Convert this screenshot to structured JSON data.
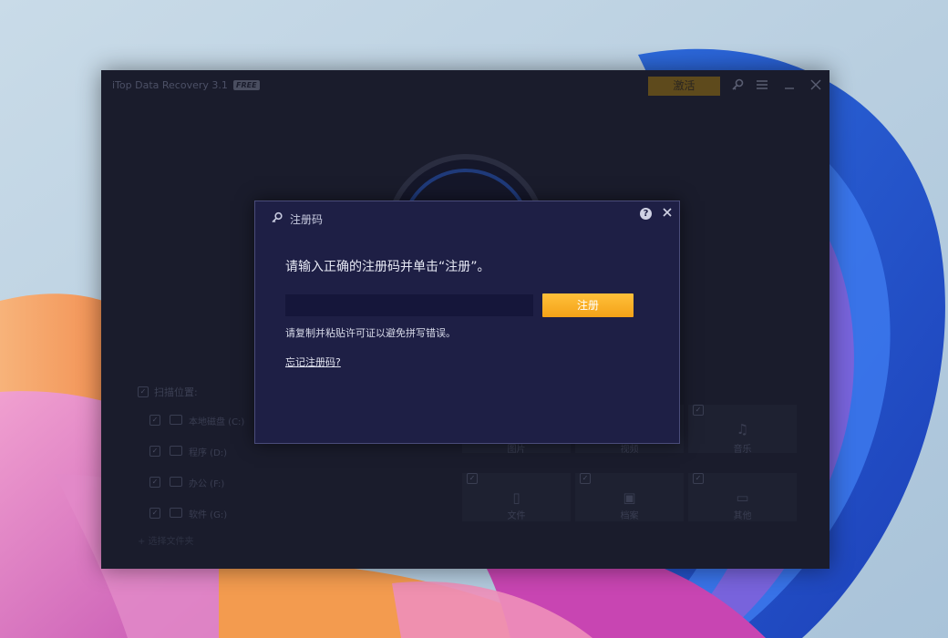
{
  "app": {
    "title": "iTop Data Recovery 3.1",
    "badge": "FREE",
    "activate_label": "激活",
    "accent_color": "#f6a723"
  },
  "scan": {
    "title": "扫描位置:",
    "drives": [
      {
        "label": "本地磁盘 (C:)",
        "icon": "computer-icon"
      },
      {
        "label": "程序 (D:)",
        "icon": "drive-icon"
      },
      {
        "label": "办公 (F:)",
        "icon": "drive-icon"
      },
      {
        "label": "软件 (G:)",
        "icon": "drive-icon"
      }
    ],
    "add_folder": "选择文件夹"
  },
  "file_types": [
    {
      "label": "图片",
      "icon": "image-icon"
    },
    {
      "label": "视频",
      "icon": "video-icon"
    },
    {
      "label": "音乐",
      "icon": "music-icon"
    },
    {
      "label": "文件",
      "icon": "document-icon"
    },
    {
      "label": "档案",
      "icon": "archive-icon"
    },
    {
      "label": "其他",
      "icon": "folder-icon"
    }
  ],
  "dialog": {
    "title": "注册码",
    "heading": "请输入正确的注册码并单击“注册”。",
    "input_value": "",
    "input_placeholder": "",
    "register_label": "注册",
    "hint": "请复制并粘贴许可证以避免拼写错误。",
    "forgot_link": "忘记注册码?"
  }
}
